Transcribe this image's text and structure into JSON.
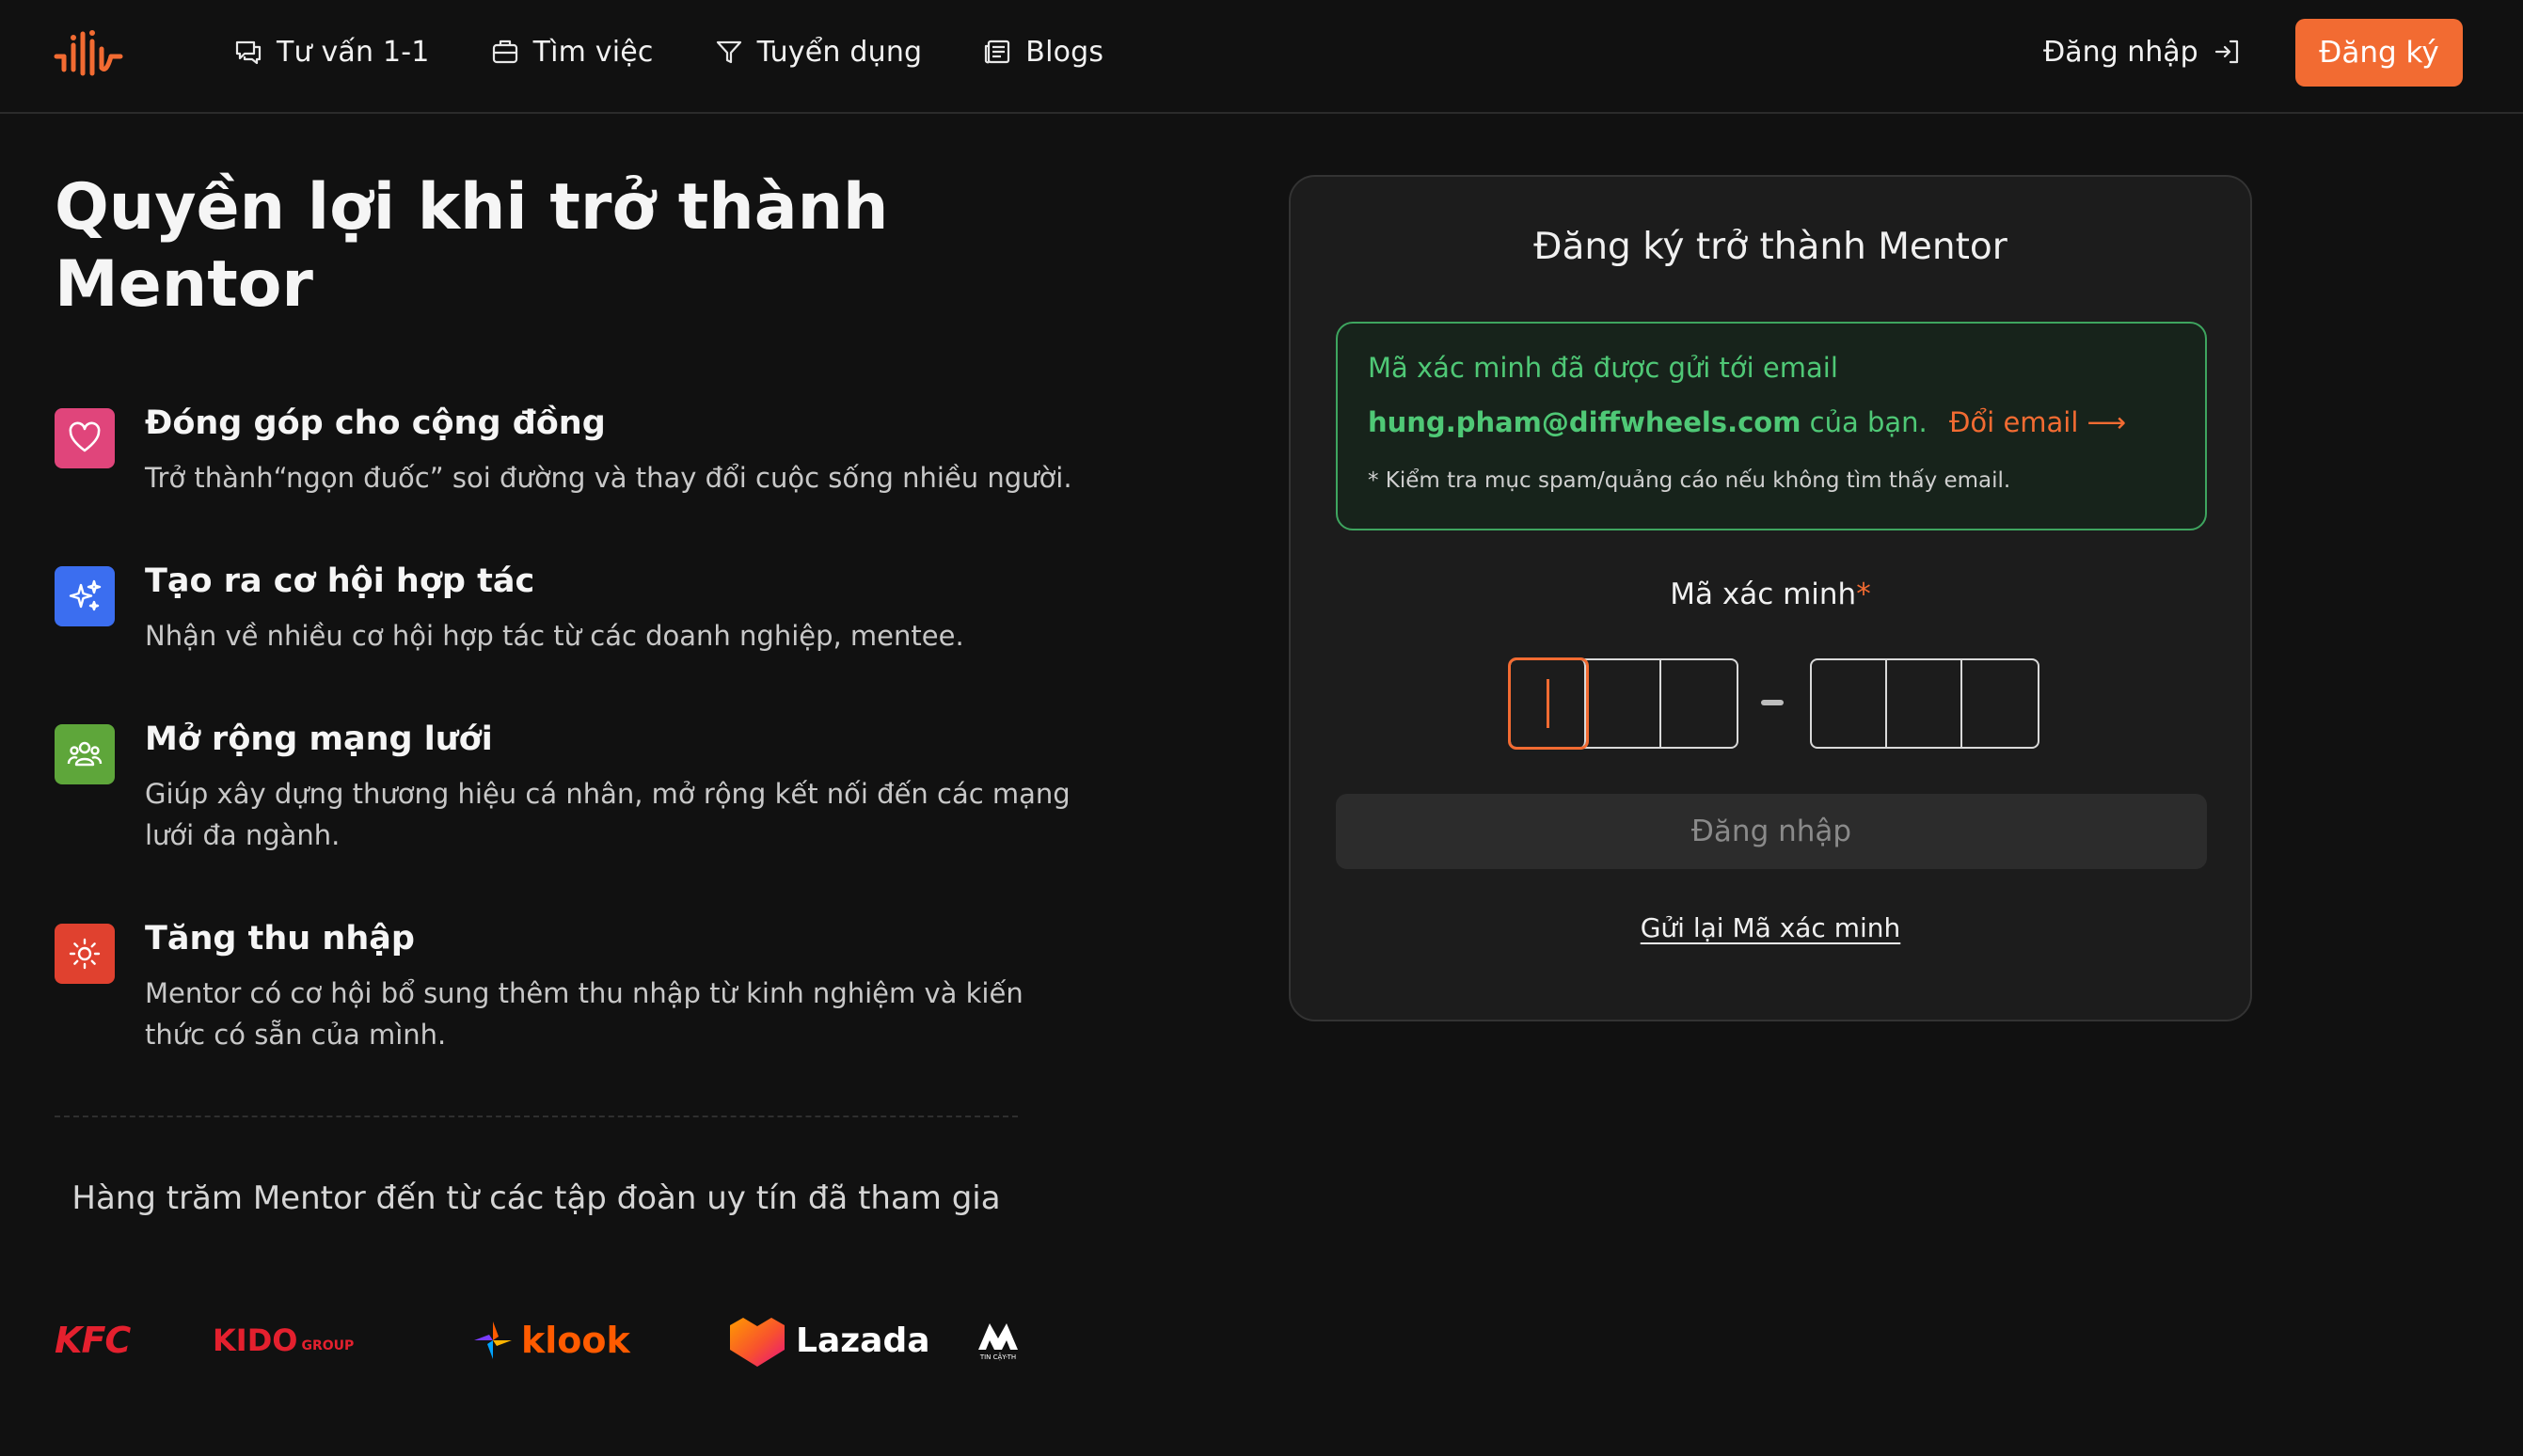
{
  "header": {
    "nav": [
      {
        "label": "Tư vấn 1-1",
        "icon": "chat-icon"
      },
      {
        "label": "Tìm việc",
        "icon": "briefcase-icon"
      },
      {
        "label": "Tuyển dụng",
        "icon": "filter-icon"
      },
      {
        "label": "Blogs",
        "icon": "newspaper-icon"
      }
    ],
    "login_label": "Đăng nhập",
    "signup_label": "Đăng ký",
    "accent_color": "#f26b32"
  },
  "hero": {
    "title_line1": "Quyền lợi khi trở thành",
    "title_line2": "Mentor"
  },
  "benefits": [
    {
      "title": "Đóng góp cho cộng đồng",
      "desc": "Trở thành“ngọn đuốc” soi đường và thay đổi cuộc sống nhiều người.",
      "icon": "heart-icon",
      "color": "#e0457b"
    },
    {
      "title": "Tạo ra cơ hội hợp tác",
      "desc": "Nhận về nhiều cơ hội hợp tác từ các doanh nghiệp, mentee.",
      "icon": "sparkles-icon",
      "color": "#3b6ef0"
    },
    {
      "title": "Mở rộng mạng lưới",
      "desc": "Giúp xây dựng thương hiệu cá nhân, mở rộng kết nối đến các mạng lưới đa ngành.",
      "icon": "people-icon",
      "color": "#5ea63a"
    },
    {
      "title": "Tăng thu nhập",
      "desc": "Mentor có cơ hội bổ sung thêm thu nhập từ kinh nghiệm và kiến thức có sẵn của mình.",
      "icon": "sun-icon",
      "color": "#e0412f"
    }
  ],
  "partners": {
    "text": "Hàng trăm Mentor đến từ các tập đoàn uy tín đã tham gia",
    "logos": [
      {
        "name": "KFC",
        "text": "KFC"
      },
      {
        "name": "KIDO GROUP",
        "text": "KIDO",
        "sub": "GROUP"
      },
      {
        "name": "klook",
        "text": "klook"
      },
      {
        "name": "Lazada",
        "text": "Lazada"
      },
      {
        "name": "TIN CẬY-TH",
        "sub": "TIN CẬY-TH"
      }
    ]
  },
  "card": {
    "title": "Đăng ký trở thành Mentor",
    "notice_line1": "Mã xác minh đã được gửi tới email",
    "email": "hung.pham@diffwheels.com",
    "notice_suffix": "của bạn.",
    "change_email": "Đổi email ⟶",
    "notice_note": "* Kiểm tra mục spam/quảng cáo nếu không tìm thấy email.",
    "code_label": "Mã xác minh",
    "required_mark": "*",
    "submit_label": "Đăng nhập",
    "resend_label": "Gửi lại Mã xác minh"
  }
}
